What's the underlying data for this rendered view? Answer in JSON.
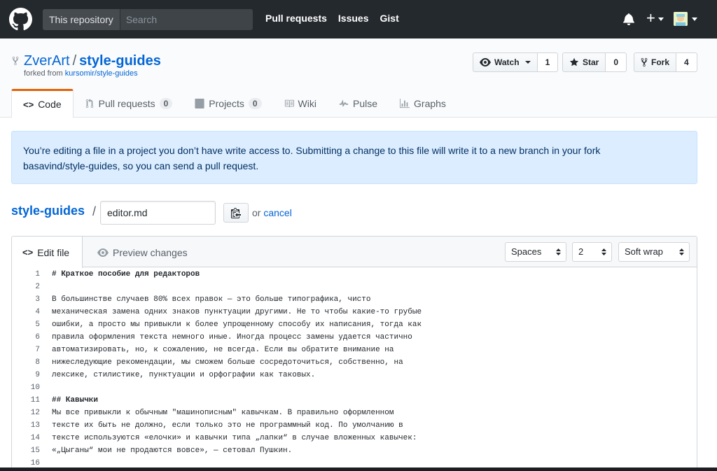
{
  "topbar": {
    "scope_label": "This repository",
    "search_placeholder": "Search",
    "nav": [
      "Pull requests",
      "Issues",
      "Gist"
    ],
    "plus": "+"
  },
  "repo": {
    "owner": "ZverArt",
    "separator": "/",
    "name": "style-guides",
    "forked_prefix": "forked from ",
    "forked_from": "kursomir/style-guides",
    "watch_label": "Watch",
    "watch_count": "1",
    "star_label": "Star",
    "star_count": "0",
    "fork_label": "Fork",
    "fork_count": "4"
  },
  "tabs": [
    {
      "label": "Code",
      "icon": "code-icon"
    },
    {
      "label": "Pull requests",
      "count": "0",
      "icon": "pull-request-icon"
    },
    {
      "label": "Projects",
      "count": "0",
      "icon": "project-icon"
    },
    {
      "label": "Wiki",
      "icon": "book-icon"
    },
    {
      "label": "Pulse",
      "icon": "pulse-icon"
    },
    {
      "label": "Graphs",
      "icon": "graph-icon"
    }
  ],
  "flash": {
    "line1": "You’re editing a file in a project you don’t have write access to. Submitting a change to this file will write it to a new branch in your fork",
    "line2": "basavind/style-guides, so you can send a pull request."
  },
  "breadcrumb": {
    "repo": "style-guides",
    "separator": "/",
    "filename": "editor.md",
    "or_text": "or",
    "cancel": "cancel"
  },
  "editor": {
    "edit_tab": "Edit file",
    "preview_tab": "Preview changes",
    "indent_mode": "Spaces",
    "indent_size": "2",
    "wrap_mode": "Soft wrap",
    "lines": [
      {
        "n": "1",
        "text": "# Краткое пособие для редакторов",
        "bold": true
      },
      {
        "n": "2",
        "text": ""
      },
      {
        "n": "3",
        "text": "В большинстве случаев 80% всех правок — это больше типографика, чисто"
      },
      {
        "n": "4",
        "text": "механическая замена одних знаков пунктуации другими. Не то чтобы какие-то грубые"
      },
      {
        "n": "5",
        "text": "ошибки, а просто мы привыкли к более упрощенному способу их написания, тогда как"
      },
      {
        "n": "6",
        "text": "правила оформления текста немного иные. Иногда процесс замены удается частично"
      },
      {
        "n": "7",
        "text": "автоматизировать, но, к сожалению, не всегда. Если вы обратите внимание на"
      },
      {
        "n": "8",
        "text": "нижеследующие рекомендации, мы сможем больше сосредоточиться, собственно, на"
      },
      {
        "n": "9",
        "text": "лексике, стилистике, пунктуации и орфографии как таковых."
      },
      {
        "n": "10",
        "text": ""
      },
      {
        "n": "11",
        "text": "## Кавычки",
        "bold": true
      },
      {
        "n": "12",
        "text": "Мы все привыкли к обычным \"машинописным\" кавычкам. В правильно оформленном"
      },
      {
        "n": "13",
        "text": "тексте их быть не должно, если только это не программный код. По умолчанию в"
      },
      {
        "n": "14",
        "text": "тексте используются «елочки» и кавычки типа „лапки“ в случае вложенных кавычек:"
      },
      {
        "n": "15",
        "text": "«„Цыганы“ мои не продаются вовсе», — сетовал Пушкин."
      },
      {
        "n": "16",
        "text": ""
      }
    ]
  }
}
